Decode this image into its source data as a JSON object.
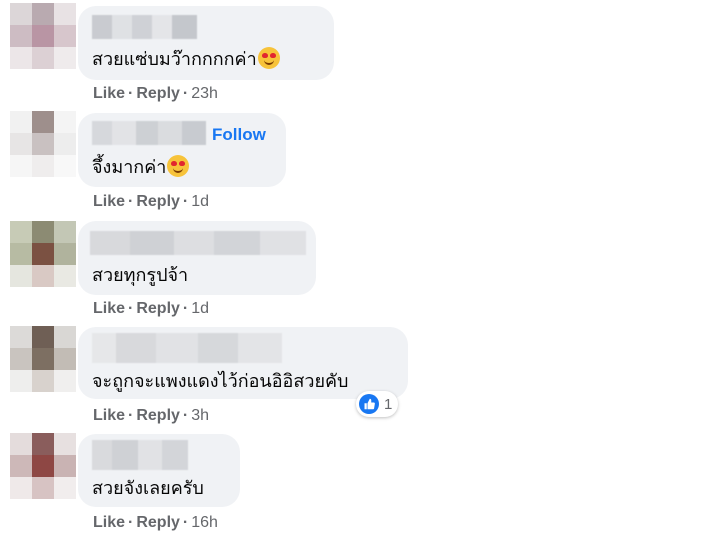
{
  "comments": [
    {
      "text": "สวยแซ่บมว๊ากกกกค่า",
      "emoji": "smiling-face-with-hearts-icon",
      "actions": {
        "like": "Like",
        "reply": "Reply",
        "time": "23h"
      }
    },
    {
      "follow": "Follow",
      "text": "จึ้งมากค่า",
      "emoji": "heart-eyes-icon",
      "actions": {
        "like": "Like",
        "reply": "Reply",
        "time": "1d"
      }
    },
    {
      "text": "สวยทุกรูปจ้า",
      "actions": {
        "like": "Like",
        "reply": "Reply",
        "time": "1d"
      }
    },
    {
      "text": "จะถูกจะแพงแดงไว้ก่อนอิอิสวยคับ",
      "reaction_count": "1",
      "actions": {
        "like": "Like",
        "reply": "Reply",
        "time": "3h"
      }
    },
    {
      "text": "สวยจังเลยครับ",
      "actions": {
        "like": "Like",
        "reply": "Reply",
        "time": "16h"
      }
    }
  ],
  "separator": "·",
  "colors": {
    "bubble": "#f0f2f5",
    "action_text": "#65676b",
    "follow": "#1877f2",
    "like_reaction": "#1877f2"
  }
}
